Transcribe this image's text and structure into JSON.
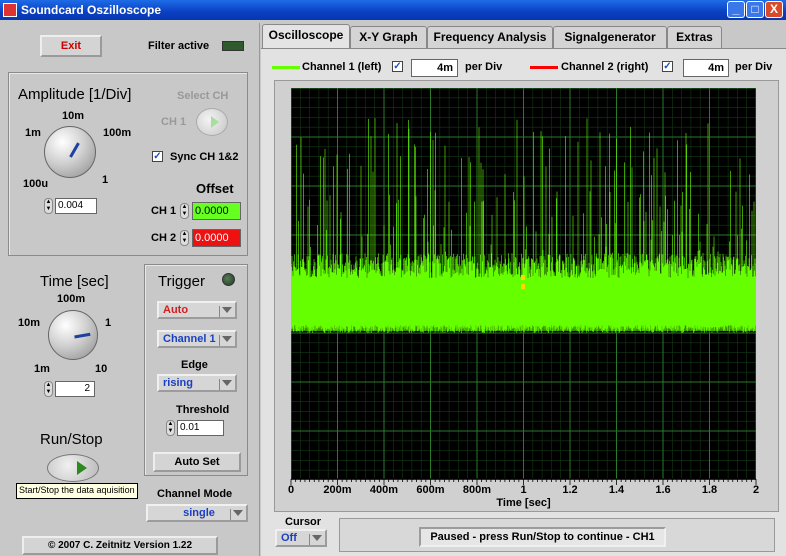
{
  "window": {
    "title": "Soundcard Oszilloscope",
    "minimize": "_",
    "maximize": "□",
    "close": "X"
  },
  "controls": {
    "exit_label": "Exit",
    "filter_label": "Filter active",
    "amplitude": {
      "title": "Amplitude [1/Div]",
      "tick_10m": "10m",
      "tick_1m": "1m",
      "tick_100m": "100m",
      "tick_100u": "100u",
      "tick_1": "1",
      "value": "0.004"
    },
    "select_ch": {
      "title": "Select CH",
      "ch_label": "CH 1"
    },
    "sync": {
      "label": "Sync CH 1&2",
      "checked": "✓"
    },
    "offset": {
      "title": "Offset",
      "ch1_label": "CH 1",
      "ch1_value": "0.0000",
      "ch2_label": "CH 2",
      "ch2_value": "0.0000"
    },
    "time": {
      "title": "Time [sec]",
      "tick_100m": "100m",
      "tick_10m": "10m",
      "tick_1": "1",
      "tick_1m": "1m",
      "tick_10": "10",
      "value": "2"
    },
    "trigger": {
      "title": "Trigger",
      "mode": "Auto",
      "channel": "Channel 1",
      "edge_label": "Edge",
      "edge": "rising",
      "threshold_label": "Threshold",
      "threshold": "0.01",
      "autoset_label": "Auto Set"
    },
    "runstop": {
      "title": "Run/Stop",
      "tooltip": "Start/Stop the data aquisition"
    },
    "channel_mode": {
      "label": "Channel Mode",
      "value": "single"
    },
    "copyright": "© 2007  C. Zeitnitz Version 1.22"
  },
  "tabs": [
    "Oscilloscope",
    "X-Y Graph",
    "Frequency Analysis",
    "Signalgenerator",
    "Extras"
  ],
  "legend": {
    "ch1": {
      "label": "Channel 1 (left)",
      "checked": "✓",
      "per_div_value": "4m",
      "per_div_label": "per Div",
      "color": "#66ff00"
    },
    "ch2": {
      "label": "Channel 2 (right)",
      "checked": "✓",
      "per_div_value": "4m",
      "per_div_label": "per Div",
      "color": "#ff0000"
    }
  },
  "plot": {
    "x_ticks": [
      "0",
      "200m",
      "400m",
      "600m",
      "800m",
      "1",
      "1.2",
      "1.4",
      "1.6",
      "1.8",
      "2"
    ],
    "x_label": "Time [sec]",
    "trace_color": "#66ff00",
    "background": "#000000",
    "grid_color": "#2a7a2a"
  },
  "cursor": {
    "label": "Cursor",
    "value": "Off"
  },
  "status": "Paused - press Run/Stop to continue - CH1"
}
